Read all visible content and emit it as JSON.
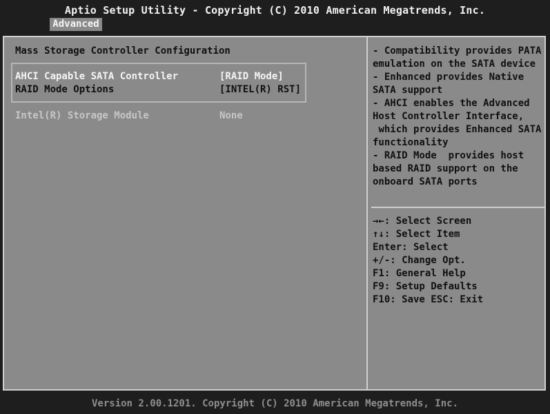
{
  "header": {
    "title": "Aptio Setup Utility - Copyright (C) 2010 American Megatrends, Inc.",
    "tab": "Advanced"
  },
  "main": {
    "section_title": "Mass Storage Controller Configuration",
    "options": [
      {
        "label": "AHCI Capable SATA Controller",
        "value": "[RAID Mode]"
      },
      {
        "label": "RAID Mode Options",
        "value": "[INTEL(R) RST]"
      },
      {
        "label": "Intel(R) Storage Module",
        "value": "None"
      }
    ]
  },
  "help": {
    "text": "- Compatibility provides PATA\nemulation on the SATA device\n- Enhanced provides Native\nSATA support\n- AHCI enables the Advanced\nHost Controller Interface,\n which provides Enhanced SATA\nfunctionality\n- RAID Mode  provides host\nbased RAID support on the\nonboard SATA ports",
    "keys": [
      "→←: Select Screen",
      "↑↓: Select Item",
      "Enter: Select",
      "+/-: Change Opt.",
      "F1: General Help",
      "F9: Setup Defaults",
      "F10: Save  ESC: Exit"
    ]
  },
  "footer": {
    "text": "Version 2.00.1201. Copyright (C) 2010 American Megatrends, Inc."
  },
  "colors": {
    "background": "#1e1e1e",
    "panel": "#8a8a8a",
    "highlight": "#f4f4f4",
    "text": "#101010"
  }
}
